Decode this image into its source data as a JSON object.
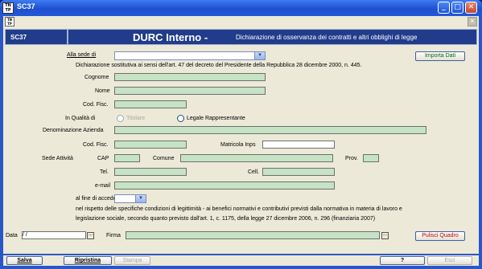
{
  "window": {
    "title": "SC37",
    "app_icon": "TIN\nTP",
    "controls": {
      "minimize": "_",
      "maximize": "□",
      "close": "✕"
    }
  },
  "header": {
    "code": "SC37",
    "title": "DURC Interno -",
    "subtitle": "Dichiarazione di osservanza dei contratti e altri obblighi di legge"
  },
  "form": {
    "sede_label": "Alla sede di",
    "sede_value": "",
    "import_button": "Importa Dati",
    "declaration": "Dichiarazione sostitutiva ai sensi dell'art. 47 del decreto del Presidente della Repubblica 28 dicembre 2000, n. 445.",
    "cognome_label": "Cognome",
    "nome_label": "Nome",
    "codfisc_label": "Cod. Fisc.",
    "qualita_label": "In Qualità di",
    "titolare_label": "Titolare",
    "legale_label": "Legale Rappresentante",
    "denominazione_label": "Denominazione Azienda",
    "codfisc2_label": "Cod. Fisc.",
    "matricola_label": "Matricola Inps",
    "sede_attivita_label": "Sede Attività",
    "cap_label": "CAP",
    "comune_label": "Comune",
    "prov_label": "Prov.",
    "tel_label": "Tel.",
    "cell_label": "Cell.",
    "email_label": "e-mail",
    "anno_label": "al fine di accedere nell'anno",
    "text1": "nel rispetto delle specifiche condizioni di legittimità - ai benefici normativi e contributivi previsti dalla normativa in materia di lavoro e",
    "text2": "legislazione sociale, secondo quanto previsto dall'art. 1, c. 1175, della legge 27 dicembre 2006, n. 296 (finanziaria 2007)",
    "data_label": "Data",
    "data_value": " / /",
    "firma_label": "Firma",
    "dots": "...",
    "clear_button": "Pulisci Quadro"
  },
  "bottom": {
    "salva": "Salva",
    "ripristina": "Ripristina",
    "stampa": "Stampa",
    "help": "?",
    "esci": "Esci"
  }
}
